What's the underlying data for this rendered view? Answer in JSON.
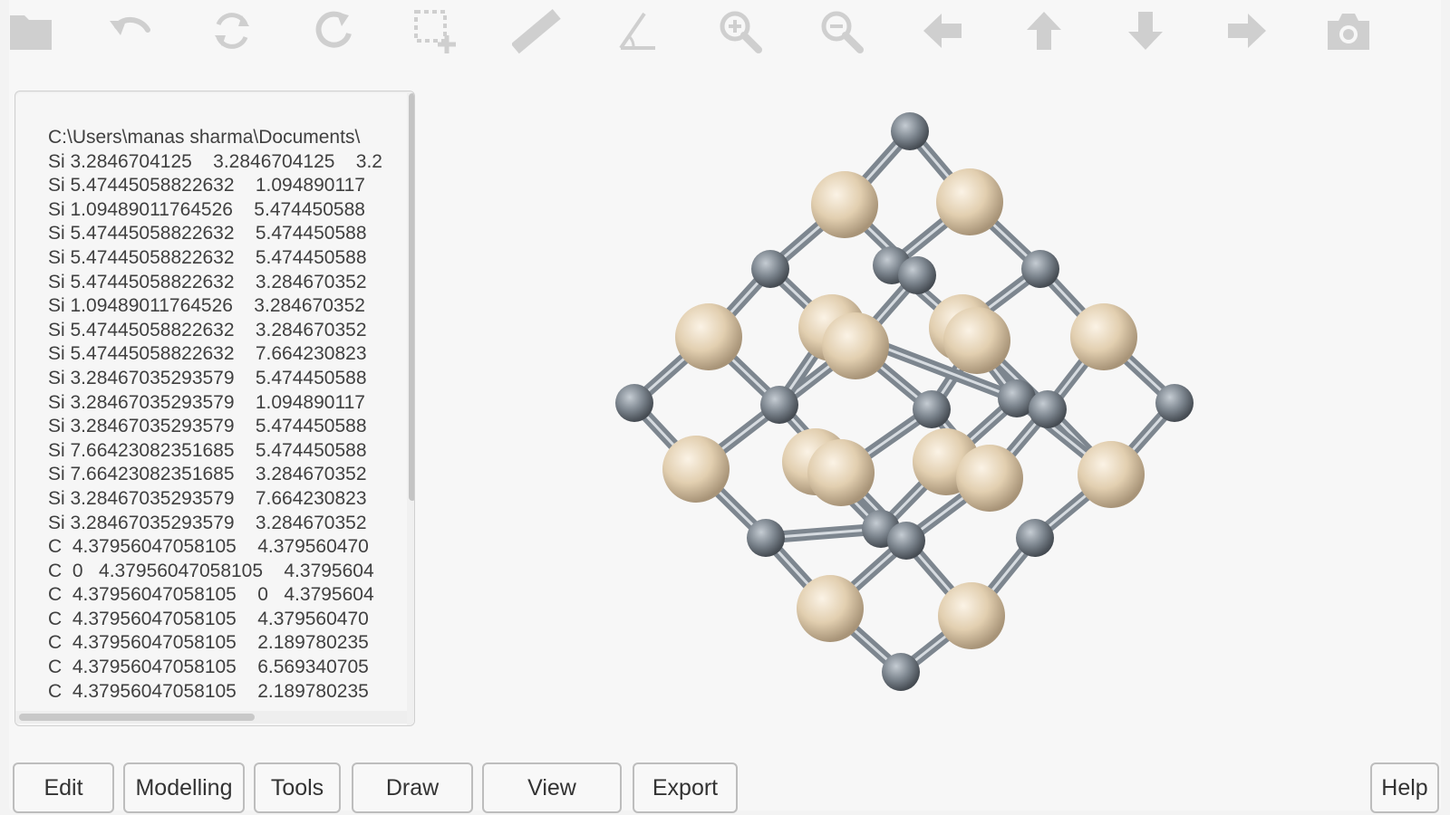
{
  "toolbar": {
    "icons": [
      "folder-icon",
      "undo-icon",
      "rotate-icon",
      "redo-icon",
      "select-icon",
      "ruler-icon",
      "angle-icon",
      "zoom-in-icon",
      "zoom-out-icon",
      "arrow-left-icon",
      "arrow-up-icon",
      "arrow-down-icon",
      "arrow-right-icon",
      "camera-icon"
    ]
  },
  "file_panel": {
    "lines": [
      "C:\\Users\\manas sharma\\Documents\\",
      "Si 3.2846704125    3.2846704125    3.2",
      "Si 5.47445058822632    1.094890117",
      "Si 1.09489011764526    5.474450588",
      "Si 5.47445058822632    5.474450588",
      "Si 5.47445058822632    5.474450588",
      "Si 5.47445058822632    3.284670352",
      "Si 1.09489011764526    3.284670352",
      "Si 5.47445058822632    3.284670352",
      "Si 5.47445058822632    7.664230823",
      "Si 3.28467035293579    5.474450588",
      "Si 3.28467035293579    1.094890117",
      "Si 3.28467035293579    5.474450588",
      "Si 7.66423082351685    5.474450588",
      "Si 7.66423082351685    3.284670352",
      "Si 3.28467035293579    7.664230823",
      "Si 3.28467035293579    3.284670352",
      "C  4.37956047058105    4.379560470",
      "C  0   4.37956047058105    4.3795604",
      "C  4.37956047058105    0   4.3795604",
      "C  4.37956047058105    4.379560470",
      "C  4.37956047058105    2.189780235",
      "C  4.37956047058105    6.569340705",
      "C  4.37956047058105    2.189780235"
    ]
  },
  "menu": {
    "edit": "Edit",
    "modelling": "Modelling",
    "tools": "Tools",
    "draw": "Draw",
    "view": "View",
    "export": "Export",
    "help": "Help"
  },
  "colors": {
    "silicon_atom": "#e6d3b3",
    "carbon_atom": "#7c858e",
    "icon": "#cfcfcf"
  }
}
